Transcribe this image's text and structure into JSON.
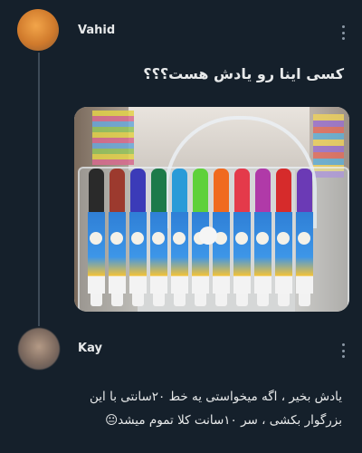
{
  "thread": [
    {
      "username": "Vahid",
      "text": "کسی اینا رو یادش هست؟؟؟",
      "avatar_icon": "profile-avatar",
      "media": {
        "icon": "markers-photo",
        "marker_colors": [
          "#2a2a2a",
          "#9c3a2e",
          "#3b3bb8",
          "#1d7a4a",
          "#2a9bd8",
          "#5fd13a",
          "#f06a1f",
          "#e43a4a",
          "#b03aa8",
          "#d62b2b",
          "#6b3ab5"
        ]
      }
    },
    {
      "username": "Kay",
      "text_lines": [
        "یادش بخیر ، اگه میخواستی یه خط ۲۰سانتی با این",
        "بزرگوار بکشی ، سر ۱۰سانت کلا تموم میشد😐"
      ],
      "avatar_icon": "profile-avatar"
    }
  ],
  "colors": {
    "background": "#15202b",
    "text": "#e7e9ea",
    "muted": "#8b98a5",
    "thread_line": "#3d4a57"
  }
}
